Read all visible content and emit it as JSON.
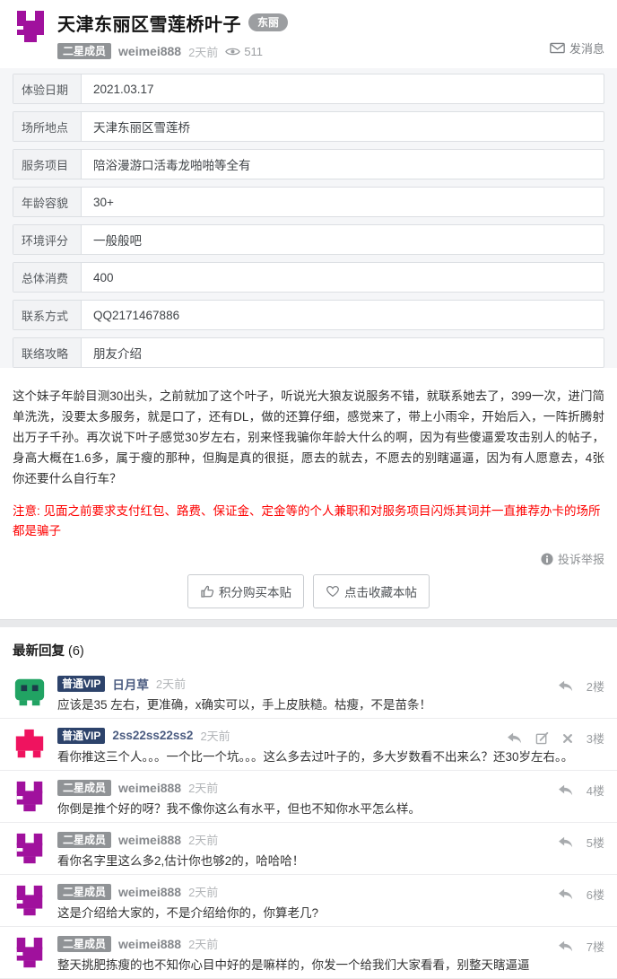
{
  "header": {
    "title": "天津东丽区雪莲桥叶子",
    "region_badge": "东丽",
    "member_badge": "二星成员",
    "username": "weimei888",
    "time": "2天前",
    "views": "511",
    "send_message": "发消息"
  },
  "fields": [
    {
      "label": "体验日期",
      "value": "2021.03.17"
    },
    {
      "label": "场所地点",
      "value": "天津东丽区雪莲桥"
    },
    {
      "label": "服务项目",
      "value": "陪浴漫游口活毒龙啪啪等全有"
    },
    {
      "label": "年龄容貌",
      "value": "30+"
    },
    {
      "label": "环境评分",
      "value": "一般般吧"
    },
    {
      "label": "总体消费",
      "value": "400"
    },
    {
      "label": "联系方式",
      "value": "QQ2171467886"
    },
    {
      "label": "联络攻略",
      "value": "朋友介绍"
    }
  ],
  "post": {
    "body": "这个妹子年龄目测30出头，之前就加了这个叶子，听说光大狼友说服务不错，就联系她去了，399一次，进门简单洗洗，没要太多服务，就是口了，还有DL，做的还算仔细，感觉来了，带上小雨伞，开始后入，一阵折腾射出万子千孙。再次说下叶子感觉30岁左右，别来怪我骗你年龄大什么的啊，因为有些傻逼爱攻击别人的帖子，身高大概在1.6多，属于瘦的那种，但胸是真的很挺，愿去的就去，不愿去的别瞎逼逼，因为有人愿意去，4张你还要什么自行车？",
    "warning": "注意: 见面之前要求支付红包、路费、保证金、定金等的个人兼职和对服务项目闪烁其词并一直推荐办卡的场所都是骗子",
    "report": "投诉举报",
    "buy_button": "积分购买本贴",
    "fav_button": "点击收藏本帖"
  },
  "replies": {
    "title": "最新回复",
    "count": "(6)",
    "items": [
      {
        "badge": "普通VIP",
        "username": "日月草",
        "time": "2天前",
        "floor": "2楼",
        "text": "应该是35 左右，更准确，x确实可以，手上皮肤糙。枯瘦，不是苗条！"
      },
      {
        "badge": "普通VIP",
        "username": "2ss22ss22ss2",
        "time": "2天前",
        "floor": "3楼",
        "text": "看你推这三个人。。。一个比一个坑。。。这么多去过叶子的，多大岁数看不出来么？还30岁左右。。"
      },
      {
        "badge": "二星成员",
        "username": "weimei888",
        "time": "2天前",
        "floor": "4楼",
        "text": "你倒是推个好的呀？我不像你这么有水平，但也不知你水平怎么样。"
      },
      {
        "badge": "二星成员",
        "username": "weimei888",
        "time": "2天前",
        "floor": "5楼",
        "text": "看你名字里这么多2,估计你也够2的，哈哈哈！"
      },
      {
        "badge": "二星成员",
        "username": "weimei888",
        "time": "2天前",
        "floor": "6楼",
        "text": "这是介绍给大家的，不是介绍给你的，你算老几?"
      },
      {
        "badge": "二星成员",
        "username": "weimei888",
        "time": "2天前",
        "floor": "7楼",
        "text": "整天挑肥拣瘦的也不知你心目中好的是嘛样的，你发一个给我们大家看看，别整天瞎逼逼"
      }
    ]
  },
  "colors": {
    "logo_purple": "#a0119d",
    "avatar_green": "#21a363",
    "avatar_pink": "#ef135f",
    "vip_badge_navy": "#2d436b",
    "member_badge_gray": "#909396",
    "warning_red": "#fd0100"
  }
}
